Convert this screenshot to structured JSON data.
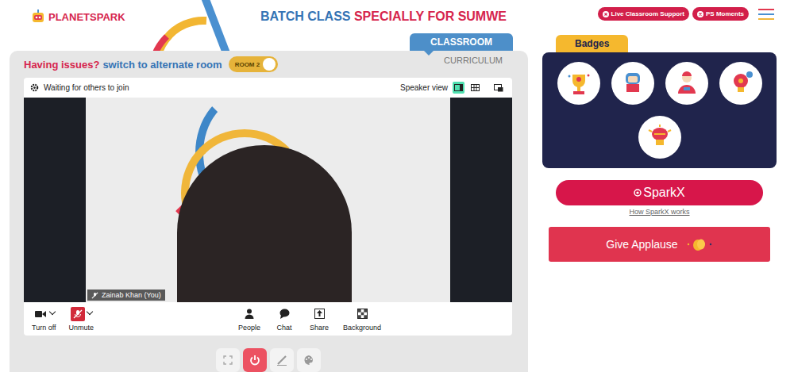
{
  "header": {
    "logo": "PLANETSPARK",
    "title_part1": "BATCH CLASS",
    "title_part2": "SPECIALLY FOR SUMWE",
    "buttons": [
      "Live Classroom Support",
      "PS Moments"
    ]
  },
  "tabs": [
    {
      "label": "CLASSROOM",
      "selected": true
    },
    {
      "label": "CURRICULUM",
      "selected": false
    }
  ],
  "room": {
    "notice": "Having issues?",
    "link": "switch to alternate room",
    "toggle_label": "ROOM 2",
    "on": true
  },
  "call": {
    "status": "Waiting for others to join",
    "view_label": "Speaker view",
    "views": [
      {
        "kind": "speaker",
        "selected": true
      },
      {
        "kind": "grid",
        "selected": false
      },
      {
        "kind": "pip",
        "selected": false
      }
    ],
    "participant": {
      "name": "Zainab Khan (You)",
      "muted": true
    },
    "controls": [
      {
        "label": "Turn off",
        "kind": "camera",
        "dropdown": true,
        "alert": false
      },
      {
        "label": "Unmute",
        "kind": "mic",
        "dropdown": true,
        "alert": true
      },
      {
        "label": "People",
        "kind": "people",
        "dropdown": false,
        "alert": false
      },
      {
        "label": "Chat",
        "kind": "chat",
        "dropdown": false,
        "alert": false
      },
      {
        "label": "Share",
        "kind": "share",
        "dropdown": false,
        "alert": false
      },
      {
        "label": "Background",
        "kind": "background",
        "dropdown": false,
        "alert": false
      }
    ]
  },
  "tools": [
    {
      "kind": "expand",
      "selected": false
    },
    {
      "kind": "power",
      "selected": true
    },
    {
      "kind": "pen",
      "selected": false
    },
    {
      "kind": "palette",
      "selected": false
    }
  ],
  "badges": {
    "title": "Badges",
    "items": [
      {
        "kind": "trophy"
      },
      {
        "kind": "hands"
      },
      {
        "kind": "leader"
      },
      {
        "kind": "idea"
      },
      {
        "kind": "brain"
      }
    ]
  },
  "sparkx": {
    "label": "SparkX",
    "link": "How SparkX works"
  },
  "applause": {
    "label": "Give Applause"
  }
}
